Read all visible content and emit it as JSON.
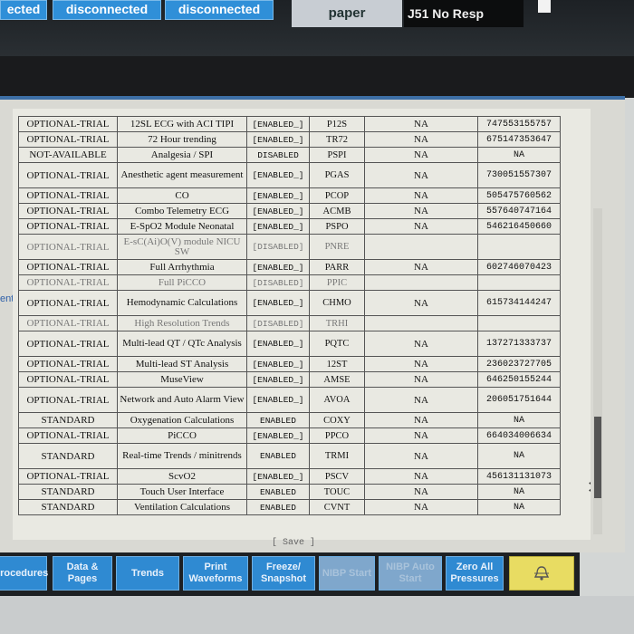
{
  "topbar": {
    "button_1": "ected",
    "button_2": "disconnected",
    "button_3": "disconnected",
    "paper": "paper",
    "resp_line_1": "J51 No Resp"
  },
  "side_label": "ent",
  "table": {
    "rows": [
      {
        "license": "OPTIONAL-TRIAL",
        "desc": "12SL ECG with ACI TIPI",
        "state": "[ENABLED_]",
        "code": "P12S",
        "na": "NA",
        "key": "747553155757",
        "h": 1
      },
      {
        "license": "OPTIONAL-TRIAL",
        "desc": "72 Hour trending",
        "state": "[ENABLED_]",
        "code": "TR72",
        "na": "NA",
        "key": "675147353647",
        "h": 1
      },
      {
        "license": "NOT-AVAILABLE",
        "desc": "Analgesia / SPI",
        "state": "DISABLED",
        "code": "PSPI",
        "na": "NA",
        "key": "NA",
        "h": 1
      },
      {
        "license": "OPTIONAL-TRIAL",
        "desc": "Anesthetic agent measurement",
        "state": "[ENABLED_]",
        "code": "PGAS",
        "na": "NA",
        "key": "730051557307",
        "h": 2
      },
      {
        "license": "OPTIONAL-TRIAL",
        "desc": "CO",
        "state": "[ENABLED_]",
        "code": "PCOP",
        "na": "NA",
        "key": "505475760562",
        "h": 1
      },
      {
        "license": "OPTIONAL-TRIAL",
        "desc": "Combo Telemetry ECG",
        "state": "[ENABLED_]",
        "code": "ACMB",
        "na": "NA",
        "key": "557640747164",
        "h": 1
      },
      {
        "license": "OPTIONAL-TRIAL",
        "desc": "E-SpO2 Module Neonatal",
        "state": "[ENABLED_]",
        "code": "PSPO",
        "na": "NA",
        "key": "546216450660",
        "h": 1
      },
      {
        "license": "OPTIONAL-TRIAL",
        "desc": "E-sC(Ai)O(V) module NICU SW",
        "state": "[DISABLED]",
        "code": "PNRE",
        "na": "",
        "key": "",
        "h": 2
      },
      {
        "license": "OPTIONAL-TRIAL",
        "desc": "Full Arrhythmia",
        "state": "[ENABLED_]",
        "code": "PARR",
        "na": "NA",
        "key": "602746070423",
        "h": 1
      },
      {
        "license": "OPTIONAL-TRIAL",
        "desc": "Full PiCCO",
        "state": "[DISABLED]",
        "code": "PPIC",
        "na": "",
        "key": "",
        "h": 1
      },
      {
        "license": "OPTIONAL-TRIAL",
        "desc": "Hemodynamic Calculations",
        "state": "[ENABLED_]",
        "code": "CHMO",
        "na": "NA",
        "key": "615734144247",
        "h": 2
      },
      {
        "license": "OPTIONAL-TRIAL",
        "desc": "High Resolution Trends",
        "state": "[DISABLED]",
        "code": "TRHI",
        "na": "",
        "key": "",
        "h": 1
      },
      {
        "license": "OPTIONAL-TRIAL",
        "desc": "Multi-lead QT / QTc Analysis",
        "state": "[ENABLED_]",
        "code": "PQTC",
        "na": "NA",
        "key": "137271333737",
        "h": 2
      },
      {
        "license": "OPTIONAL-TRIAL",
        "desc": "Multi-lead ST Analysis",
        "state": "[ENABLED_]",
        "code": "12ST",
        "na": "NA",
        "key": "236023727705",
        "h": 1
      },
      {
        "license": "OPTIONAL-TRIAL",
        "desc": "MuseView",
        "state": "[ENABLED_]",
        "code": "AMSE",
        "na": "NA",
        "key": "646250155244",
        "h": 1
      },
      {
        "license": "OPTIONAL-TRIAL",
        "desc": "Network and Auto Alarm View",
        "state": "[ENABLED_]",
        "code": "AVOA",
        "na": "NA",
        "key": "206051751644",
        "h": 2
      },
      {
        "license": "STANDARD",
        "desc": "Oxygenation Calculations",
        "state": "ENABLED",
        "code": "COXY",
        "na": "NA",
        "key": "NA",
        "h": 1
      },
      {
        "license": "OPTIONAL-TRIAL",
        "desc": "PiCCO",
        "state": "[ENABLED_]",
        "code": "PPCO",
        "na": "NA",
        "key": "664034006634",
        "h": 1
      },
      {
        "license": "STANDARD",
        "desc": "Real-time Trends / minitrends",
        "state": "ENABLED",
        "code": "TRMI",
        "na": "NA",
        "key": "NA",
        "h": 2
      },
      {
        "license": "OPTIONAL-TRIAL",
        "desc": "ScvO2",
        "state": "[ENABLED_]",
        "code": "PSCV",
        "na": "NA",
        "key": "456131131073",
        "h": 1
      },
      {
        "license": "STANDARD",
        "desc": "Touch User Interface",
        "state": "ENABLED",
        "code": "TOUC",
        "na": "NA",
        "key": "NA",
        "h": 1
      },
      {
        "license": "STANDARD",
        "desc": "Ventilation Calculations",
        "state": "ENABLED",
        "code": "CVNT",
        "na": "NA",
        "key": "NA",
        "h": 1
      }
    ]
  },
  "save_label": "[ Save ]",
  "bottombar": {
    "buttons": [
      {
        "label": "Procedures",
        "enabled": true
      },
      {
        "label": "Data & Pages",
        "enabled": true
      },
      {
        "label": "Trends",
        "enabled": true
      },
      {
        "label": "Print Waveforms",
        "enabled": true
      },
      {
        "label": "Freeze/ Snapshot",
        "enabled": true
      },
      {
        "label": "NIBP Start",
        "enabled": false
      },
      {
        "label": "NIBP Auto Start",
        "enabled": false
      },
      {
        "label": "Zero All Pressures",
        "enabled": true
      }
    ],
    "alarm_icon": "bell-silence-icon"
  },
  "colors": {
    "button_blue": "#2f8ad2",
    "alarm_yellow": "#e8dc62",
    "dialog_bg": "#e9e9e2"
  }
}
